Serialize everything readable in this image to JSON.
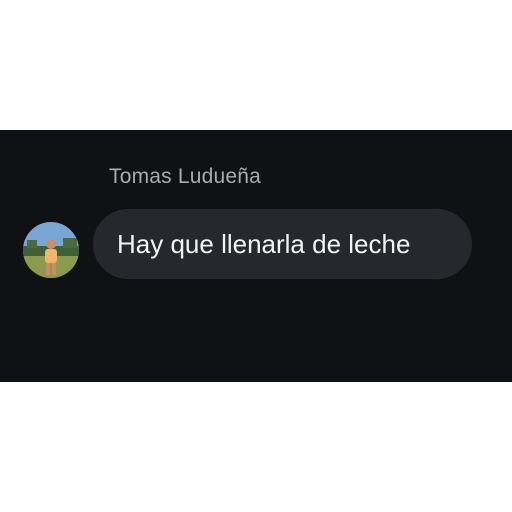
{
  "message": {
    "sender_name": "Tomas Ludueña",
    "text": "Hay que llenarla de leche",
    "avatar_icon": "user-photo-avatar"
  },
  "colors": {
    "panel_background": "#0f1115",
    "bubble_background": "#26282d",
    "sender_name_color": "#a8abb1",
    "message_text_color": "#f2f3f5"
  }
}
